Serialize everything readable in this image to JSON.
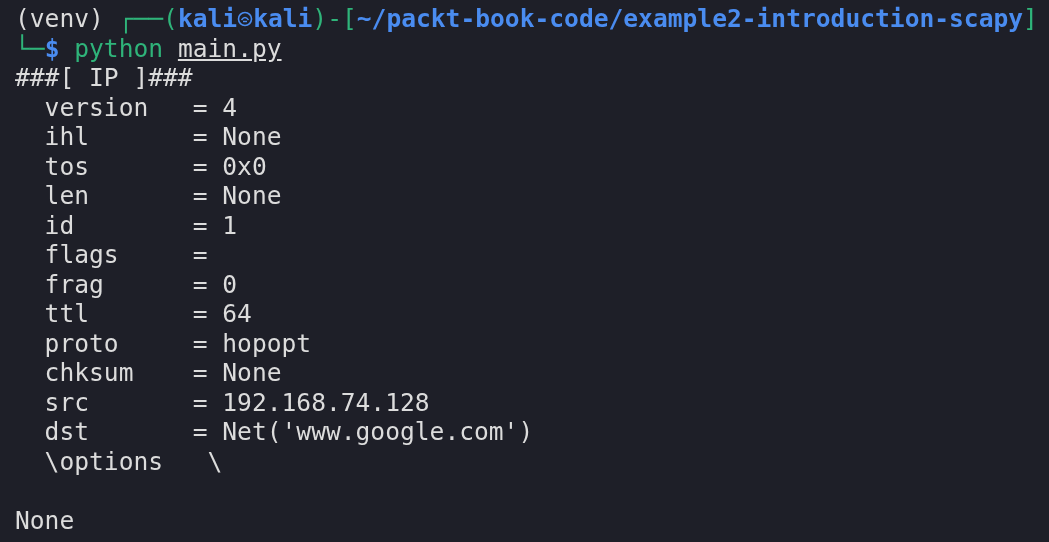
{
  "prompt": {
    "venv": "(venv)",
    "open": "┌──(",
    "user": "kali",
    "host": "kali",
    "mid": ")-[",
    "path": "~/packt-book-code/example2-introduction-scapy",
    "close": "]"
  },
  "command_line": {
    "corner": "└─",
    "symbol": "$",
    "command": "python",
    "argument": "main.py"
  },
  "output": [
    "###[ IP ]###",
    "  version   = 4",
    "  ihl       = None",
    "  tos       = 0x0",
    "  len       = None",
    "  id        = 1",
    "  flags     =",
    "  frag      = 0",
    "  ttl       = 64",
    "  proto     = hopopt",
    "  chksum    = None",
    "  src       = 192.168.74.128",
    "  dst       = Net('www.google.com')",
    "  \\options   \\"
  ],
  "result": "None"
}
